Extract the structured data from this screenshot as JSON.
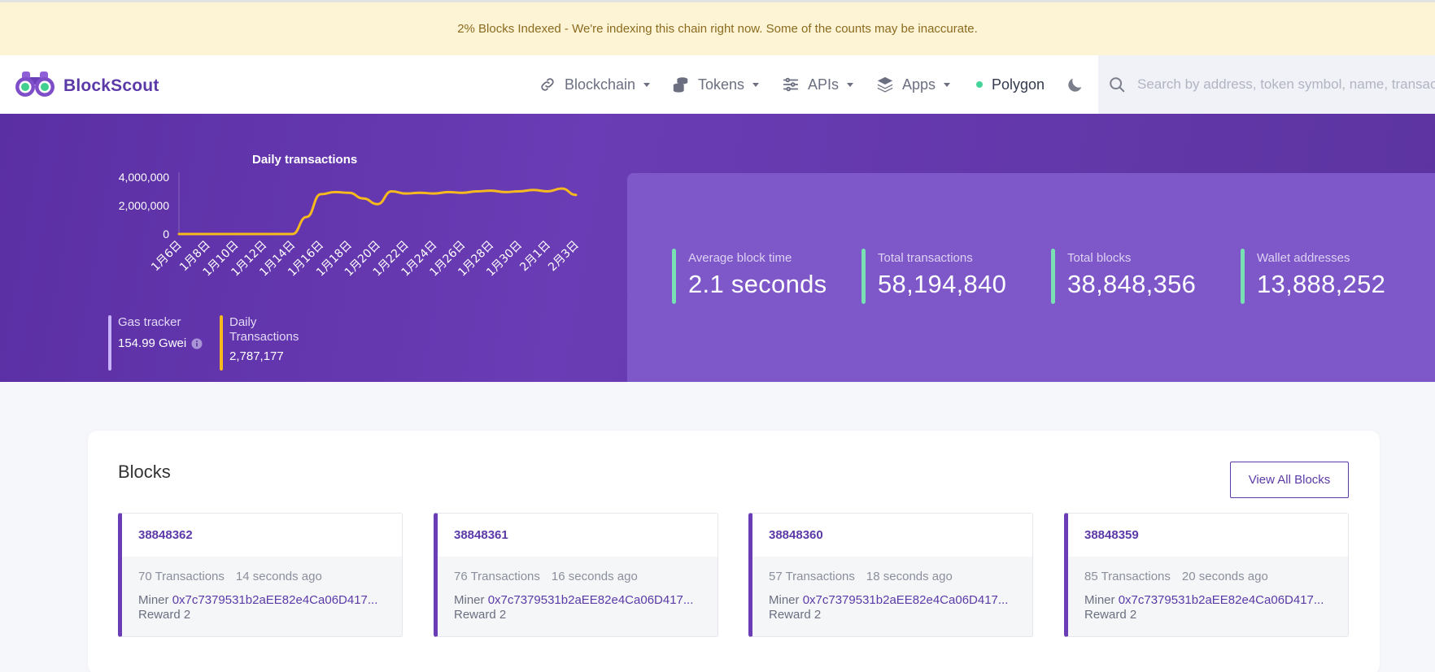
{
  "banner": {
    "text": "2% Blocks Indexed - We're indexing this chain right now. Some of the counts may be inaccurate."
  },
  "brand": {
    "name": "BlockScout"
  },
  "nav": {
    "items": [
      {
        "label": "Blockchain",
        "icon": "link-icon"
      },
      {
        "label": "Tokens",
        "icon": "coins-icon"
      },
      {
        "label": "APIs",
        "icon": "sliders-icon"
      },
      {
        "label": "Apps",
        "icon": "layers-icon"
      }
    ],
    "network": "Polygon",
    "theme_icon": "moon-icon"
  },
  "search": {
    "placeholder": "Search by address, token symbol, name, transaction hash, or block number"
  },
  "chart_data": {
    "type": "line",
    "title": "Daily transactions",
    "x": [
      "1月6日",
      "1月7日",
      "1月8日",
      "1月9日",
      "1月10日",
      "1月11日",
      "1月12日",
      "1月13日",
      "1月14日",
      "1月15日",
      "1月16日",
      "1月17日",
      "1月18日",
      "1月19日",
      "1月20日",
      "1月21日",
      "1月22日",
      "1月23日",
      "1月24日",
      "1月25日",
      "1月26日",
      "1月27日",
      "1月28日",
      "1月29日",
      "1月30日",
      "1月31日",
      "2月1日",
      "2月2日",
      "2月3日"
    ],
    "tick_labels": [
      "1月6日",
      "1月8日",
      "1月10日",
      "1月12日",
      "1月14日",
      "1月16日",
      "1月18日",
      "1月20日",
      "1月22日",
      "1月24日",
      "1月26日",
      "1月28日",
      "1月30日",
      "2月1日",
      "2月3日"
    ],
    "series": [
      {
        "values": [
          0,
          0,
          0,
          0,
          0,
          0,
          0,
          0,
          0,
          1200000,
          2800000,
          2950000,
          2900000,
          2500000,
          2100000,
          3000000,
          2850000,
          2900000,
          2850000,
          2950000,
          2900000,
          3000000,
          3050000,
          2950000,
          3000000,
          3100000,
          3000000,
          3200000,
          2750000
        ],
        "color": "#f6b91e"
      }
    ],
    "yticks": [
      "4,000,000",
      "2,000,000",
      "0"
    ],
    "ylim": [
      0,
      4000000
    ],
    "grid": false
  },
  "gas": {
    "title": "Gas tracker",
    "value": "154.99 Gwei",
    "color": "#c7b3ff"
  },
  "daily_tx": {
    "title": "Daily Transactions",
    "value": "2,787,177",
    "color": "#f6b91e"
  },
  "stats": [
    {
      "label": "Average block time",
      "value": "2.1 seconds"
    },
    {
      "label": "Total transactions",
      "value": "58,194,840"
    },
    {
      "label": "Total blocks",
      "value": "38,848,356"
    },
    {
      "label": "Wallet addresses",
      "value": "13,888,252"
    }
  ],
  "blocks": {
    "title": "Blocks",
    "view_all": "View All Blocks",
    "items": [
      {
        "number": "38848362",
        "txs": "70 Transactions",
        "age": "14 seconds ago",
        "miner_label": "Miner",
        "miner": "0x7c7379531b2aEE82e4Ca06D417...",
        "reward": "Reward 2"
      },
      {
        "number": "38848361",
        "txs": "76 Transactions",
        "age": "16 seconds ago",
        "miner_label": "Miner",
        "miner": "0x7c7379531b2aEE82e4Ca06D417...",
        "reward": "Reward 2"
      },
      {
        "number": "38848360",
        "txs": "57 Transactions",
        "age": "18 seconds ago",
        "miner_label": "Miner",
        "miner": "0x7c7379531b2aEE82e4Ca06D417...",
        "reward": "Reward 2"
      },
      {
        "number": "38848359",
        "txs": "85 Transactions",
        "age": "20 seconds ago",
        "miner_label": "Miner",
        "miner": "0x7c7379531b2aEE82e4Ca06D417...",
        "reward": "Reward 2"
      }
    ]
  }
}
